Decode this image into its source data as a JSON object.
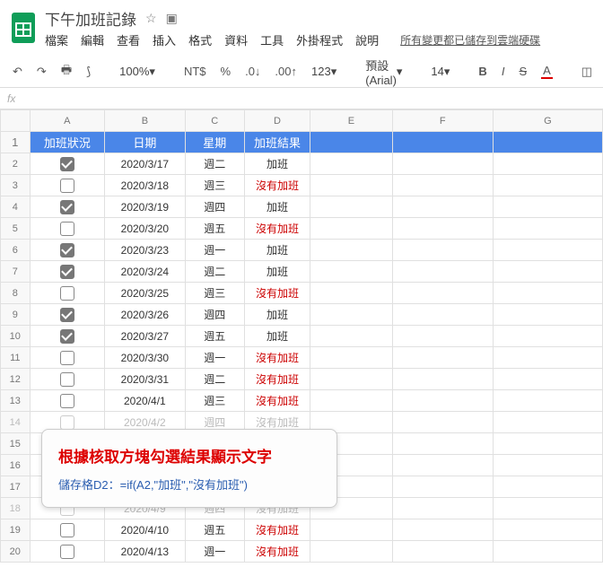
{
  "header": {
    "title": "下午加班記錄",
    "menus": [
      "檔案",
      "編輯",
      "查看",
      "插入",
      "格式",
      "資料",
      "工具",
      "外掛程式",
      "說明"
    ],
    "save_status": "所有變更都已儲存到雲端硬碟"
  },
  "toolbar": {
    "zoom": "100%",
    "currency": "NT$",
    "percent": "%",
    "dec_down": ".0",
    "dec_up": ".00",
    "numfmt": "123",
    "font": "預設 (Arial)",
    "size": "14",
    "bold": "B",
    "italic": "I",
    "strike": "S",
    "color": "A"
  },
  "formula_label": "fx",
  "columns": [
    "A",
    "B",
    "C",
    "D",
    "E",
    "F",
    "G"
  ],
  "table": {
    "headers": [
      "加班狀況",
      "日期",
      "星期",
      "加班結果"
    ],
    "rows": [
      {
        "checked": true,
        "date": "2020/3/17",
        "weekday": "週二",
        "result": "加班",
        "red": false
      },
      {
        "checked": false,
        "date": "2020/3/18",
        "weekday": "週三",
        "result": "沒有加班",
        "red": true
      },
      {
        "checked": true,
        "date": "2020/3/19",
        "weekday": "週四",
        "result": "加班",
        "red": false
      },
      {
        "checked": false,
        "date": "2020/3/20",
        "weekday": "週五",
        "result": "沒有加班",
        "red": true
      },
      {
        "checked": true,
        "date": "2020/3/23",
        "weekday": "週一",
        "result": "加班",
        "red": false
      },
      {
        "checked": true,
        "date": "2020/3/24",
        "weekday": "週二",
        "result": "加班",
        "red": false
      },
      {
        "checked": false,
        "date": "2020/3/25",
        "weekday": "週三",
        "result": "沒有加班",
        "red": true
      },
      {
        "checked": true,
        "date": "2020/3/26",
        "weekday": "週四",
        "result": "加班",
        "red": false
      },
      {
        "checked": true,
        "date": "2020/3/27",
        "weekday": "週五",
        "result": "加班",
        "red": false
      },
      {
        "checked": false,
        "date": "2020/3/30",
        "weekday": "週一",
        "result": "沒有加班",
        "red": true
      },
      {
        "checked": false,
        "date": "2020/3/31",
        "weekday": "週二",
        "result": "沒有加班",
        "red": true
      },
      {
        "checked": false,
        "date": "2020/4/1",
        "weekday": "週三",
        "result": "沒有加班",
        "red": true
      },
      {
        "checked": false,
        "date": "2020/4/2",
        "weekday": "週四",
        "result": "沒有加班",
        "red": true
      },
      {
        "checked": false,
        "date": "",
        "weekday": "",
        "result": "",
        "red": false
      },
      {
        "checked": false,
        "date": "",
        "weekday": "",
        "result": "",
        "red": false
      },
      {
        "checked": false,
        "date": "",
        "weekday": "",
        "result": "",
        "red": false
      },
      {
        "checked": false,
        "date": "2020/4/9",
        "weekday": "週四",
        "result": "沒有加班",
        "red": true,
        "faded": true
      },
      {
        "checked": false,
        "date": "2020/4/10",
        "weekday": "週五",
        "result": "沒有加班",
        "red": true
      },
      {
        "checked": false,
        "date": "2020/4/13",
        "weekday": "週一",
        "result": "沒有加班",
        "red": true
      }
    ]
  },
  "callout": {
    "line1": "根據核取方塊勾選結果顯示文字",
    "line2": "儲存格D2：=if(A2,\"加班\",\"沒有加班\")"
  }
}
